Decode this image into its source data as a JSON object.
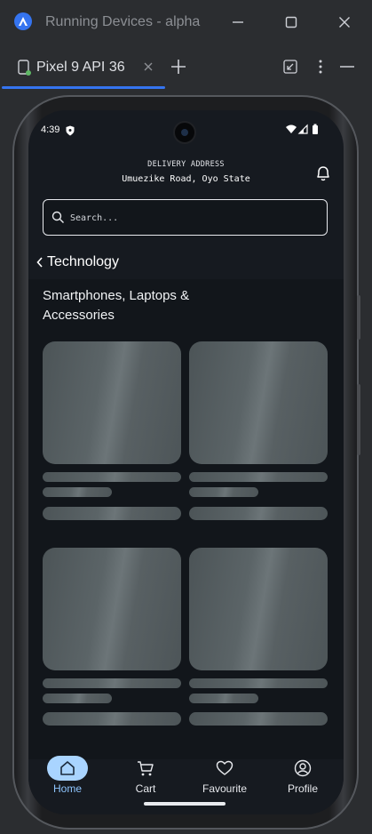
{
  "window": {
    "title": "Running Devices - alpha",
    "accent": "#3574f0"
  },
  "tabs": [
    {
      "label": "Pixel 9 API 36",
      "icon": "device-icon",
      "active": true
    }
  ],
  "status_bar": {
    "time": "4:39"
  },
  "header": {
    "address_caption": "DELIVERY ADDRESS",
    "address_value": "Umuezike Road, Oyo State"
  },
  "search": {
    "placeholder": "Search..."
  },
  "category": {
    "title": "Technology",
    "section_title": "Smartphones, Laptops & Accessories"
  },
  "bottom_nav": {
    "items": [
      {
        "label": "Home",
        "icon": "home-icon",
        "active": true
      },
      {
        "label": "Cart",
        "icon": "cart-icon",
        "active": false
      },
      {
        "label": "Favourite",
        "icon": "heart-icon",
        "active": false
      },
      {
        "label": "Profile",
        "icon": "profile-icon",
        "active": false
      }
    ],
    "active_color": "#a9d4ff"
  }
}
